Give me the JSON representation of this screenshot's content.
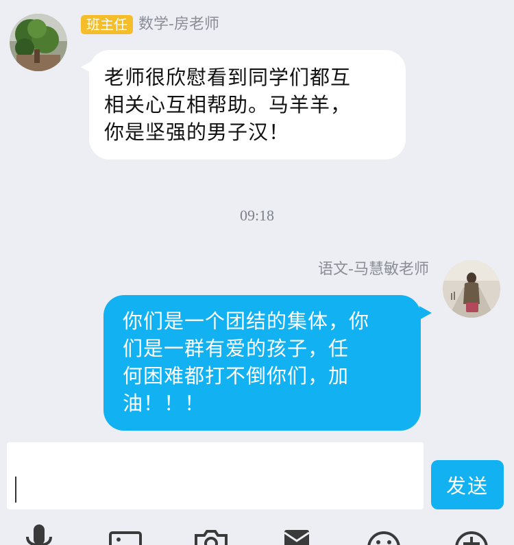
{
  "messages": [
    {
      "role_badge": "班主任",
      "sender": "数学-房老师",
      "text": "老师很欣慰看到同学们都互\n相关心互相帮助。马羊羊，\n你是坚强的男子汉！"
    },
    {
      "sender": "语文-马慧敏老师",
      "text": "你们是一个团结的集体，你\n们是一群有爱的孩子，任\n何困难都打不倒你们，加\n油！！！"
    }
  ],
  "timestamp": "09:18",
  "composer": {
    "input_value": "",
    "send_label": "发送"
  },
  "toolbar": {
    "icons": [
      "microphone-icon",
      "image-icon",
      "camera-icon",
      "red-packet-icon",
      "emoji-icon",
      "plus-icon"
    ]
  },
  "colors": {
    "accent": "#12b1f1",
    "badge": "#f6bd2a",
    "background": "#eceef4"
  }
}
